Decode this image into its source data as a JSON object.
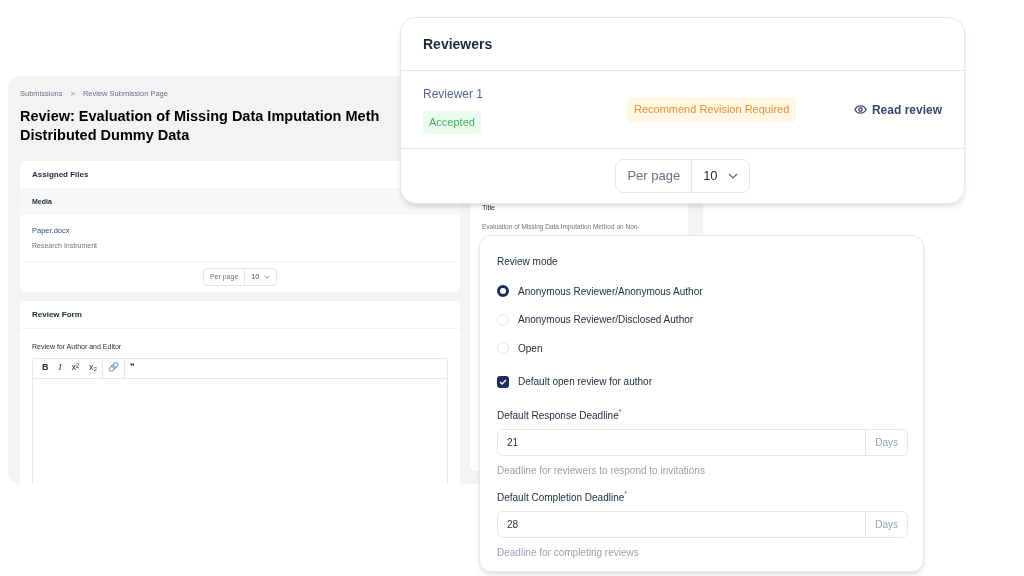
{
  "submission_page": {
    "breadcrumb": [
      "Submissions",
      "Review Submission Page"
    ],
    "breadcrumb_separator": ">",
    "title_lines": [
      "Review: Evaluation of Missing Data Imputation Meth",
      "Distributed Dummy Data"
    ],
    "assigned_files": {
      "title": "Assigned Files",
      "column": "Media",
      "files": [
        {
          "name": "Paper.docx",
          "type": "Research Instrument"
        }
      ],
      "per_page_label": "Per page",
      "per_page": "10"
    },
    "review_form": {
      "title": "Review Form",
      "label": "Review for Author and Editor",
      "toolbar": [
        "B",
        "I",
        "x²",
        "x₂",
        "🔗",
        "❞"
      ]
    },
    "details": {
      "label": "Title",
      "value": "Evaluation of Missing Data Imputation Method on Non-"
    }
  },
  "reviewers": {
    "title": "Reviewers",
    "rows": [
      {
        "name": "Reviewer 1",
        "status": "Accepted",
        "recommendation": "Recommend Revision Required",
        "action": "Read review"
      }
    ],
    "per_page_label": "Per page",
    "per_page": "10"
  },
  "settings": {
    "review_mode_label": "Review mode",
    "modes": [
      {
        "label": "Anonymous Reviewer/Anonymous Author",
        "selected": true
      },
      {
        "label": "Anonymous Reviewer/Disclosed Author",
        "selected": false
      },
      {
        "label": "Open",
        "selected": false
      }
    ],
    "default_open_review": {
      "label": "Default open review for author",
      "checked": true
    },
    "deadlines": [
      {
        "label": "Default Response Deadline",
        "required_mark": "*",
        "value": "21",
        "unit": "Days",
        "help": "Deadline for reviewers to respond to invitations"
      },
      {
        "label": "Default Completion Deadline",
        "required_mark": "*",
        "value": "28",
        "unit": "Days",
        "help": "Deadline for completing reviews"
      }
    ]
  }
}
